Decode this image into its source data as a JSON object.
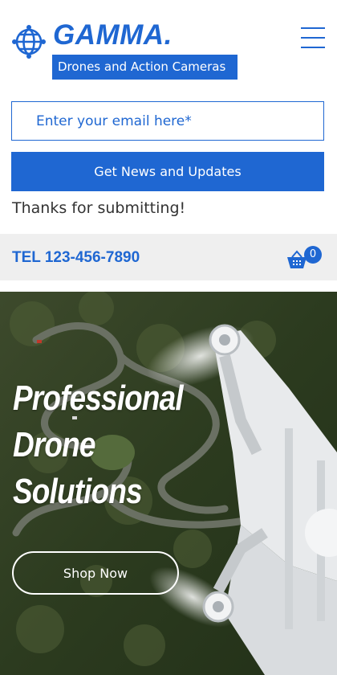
{
  "brand": {
    "name": "GAMMA.",
    "tagline": "Drones and Action Cameras",
    "accent_color": "#1f67d2"
  },
  "signup": {
    "email_placeholder": "Enter your email here*",
    "submit_label": "Get News and Updates",
    "confirmation": "Thanks for submitting!"
  },
  "contact": {
    "phone": "TEL 123-456-7890"
  },
  "cart": {
    "count": "0",
    "icon": "shopping-basket-icon"
  },
  "hero": {
    "title_lines": [
      "Professional",
      "Drone",
      "Solutions"
    ],
    "cta_label": "Shop Now"
  },
  "icons": {
    "logo": "globe-logo-icon",
    "menu": "hamburger-menu-icon"
  }
}
